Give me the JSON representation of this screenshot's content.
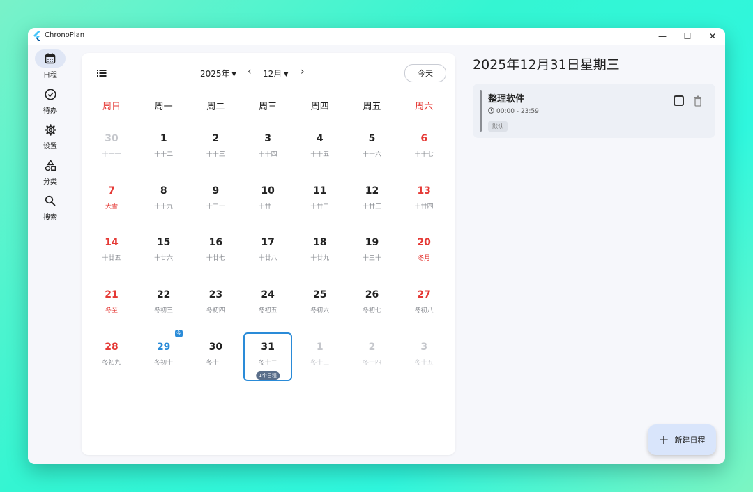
{
  "window": {
    "title": "ChronoPlan",
    "min_glyph": "—",
    "max_glyph": "☐",
    "close_glyph": "✕"
  },
  "sidebar": {
    "items": [
      {
        "label": "日程",
        "icon": "calendar-icon",
        "active": true
      },
      {
        "label": "待办",
        "icon": "check-circle-icon",
        "active": false
      },
      {
        "label": "设置",
        "icon": "gear-icon",
        "active": false
      },
      {
        "label": "分类",
        "icon": "shapes-icon",
        "active": false
      },
      {
        "label": "搜索",
        "icon": "search-icon",
        "active": false
      }
    ]
  },
  "calendar": {
    "year": "2025年",
    "month": "12月",
    "today_label": "今天",
    "weekdays": [
      "周日",
      "周一",
      "周二",
      "周三",
      "周四",
      "周五",
      "周六"
    ],
    "days": [
      {
        "n": "30",
        "l": "十一一",
        "other": true
      },
      {
        "n": "1",
        "l": "十十二"
      },
      {
        "n": "2",
        "l": "十十三"
      },
      {
        "n": "3",
        "l": "十十四"
      },
      {
        "n": "4",
        "l": "十十五"
      },
      {
        "n": "5",
        "l": "十十六"
      },
      {
        "n": "6",
        "l": "十十七"
      },
      {
        "n": "7",
        "l": "大雪",
        "festival": true
      },
      {
        "n": "8",
        "l": "十十九"
      },
      {
        "n": "9",
        "l": "十二十"
      },
      {
        "n": "10",
        "l": "十廿一"
      },
      {
        "n": "11",
        "l": "十廿二"
      },
      {
        "n": "12",
        "l": "十廿三"
      },
      {
        "n": "13",
        "l": "十廿四"
      },
      {
        "n": "14",
        "l": "十廿五"
      },
      {
        "n": "15",
        "l": "十廿六"
      },
      {
        "n": "16",
        "l": "十廿七"
      },
      {
        "n": "17",
        "l": "十廿八"
      },
      {
        "n": "18",
        "l": "十廿九"
      },
      {
        "n": "19",
        "l": "十三十"
      },
      {
        "n": "20",
        "l": "冬月",
        "festival": true
      },
      {
        "n": "21",
        "l": "冬至",
        "festival": true
      },
      {
        "n": "22",
        "l": "冬初三"
      },
      {
        "n": "23",
        "l": "冬初四"
      },
      {
        "n": "24",
        "l": "冬初五"
      },
      {
        "n": "25",
        "l": "冬初六"
      },
      {
        "n": "26",
        "l": "冬初七"
      },
      {
        "n": "27",
        "l": "冬初八"
      },
      {
        "n": "28",
        "l": "冬初九"
      },
      {
        "n": "29",
        "l": "冬初十",
        "today": true,
        "badge": "今"
      },
      {
        "n": "30",
        "l": "冬十一"
      },
      {
        "n": "31",
        "l": "冬十二",
        "selected": true,
        "events": "1个日程"
      },
      {
        "n": "1",
        "l": "冬十三",
        "other": true
      },
      {
        "n": "2",
        "l": "冬十四",
        "other": true
      },
      {
        "n": "3",
        "l": "冬十五",
        "other": true
      }
    ]
  },
  "detail": {
    "date_title": "2025年12月31日星期三",
    "event": {
      "title": "整理软件",
      "time": "00:00 - 23:59",
      "tag": "默认"
    }
  },
  "fab": {
    "label": "新建日程",
    "plus": "+"
  },
  "colors": {
    "accent": "#2a8bd8",
    "weekend": "#e53935",
    "fab_bg": "#d9e5fb"
  }
}
